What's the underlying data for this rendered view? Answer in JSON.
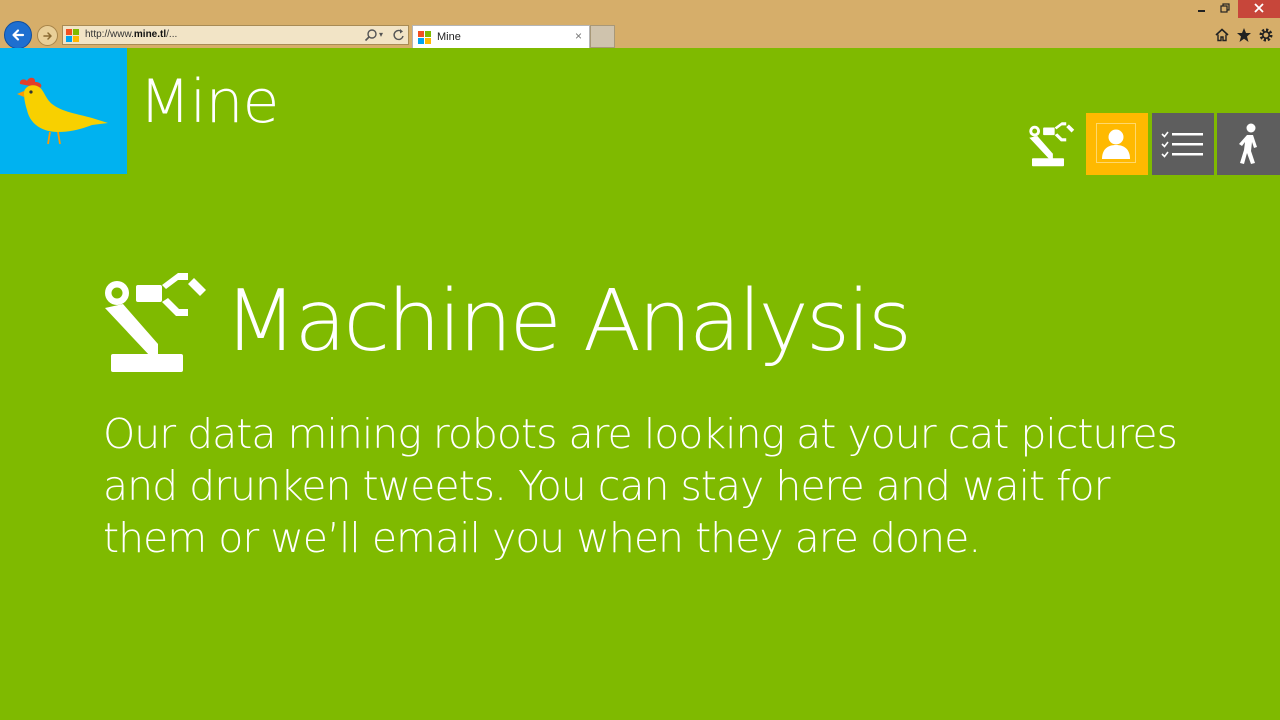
{
  "browser": {
    "address_prefix": "http://www.",
    "address_domain": "mine.tl",
    "address_suffix": "/...",
    "tab_title": "Mine",
    "tab_close": "×",
    "address_dropdown": "▾"
  },
  "app": {
    "title": "Mine",
    "colors": {
      "background": "#7fba00",
      "logo_tile": "#00b2f0",
      "user_tile": "#ffb900",
      "dark_tile": "#5e5e5e"
    }
  },
  "main": {
    "title": "Machine Analysis",
    "body_lines": [
      "Our data mining robots are looking at your cat pictures",
      "and drunken tweets. You can stay here and wait for",
      "them or we’ll email you when they are done."
    ]
  },
  "icons": {
    "back": "back-arrow-icon",
    "forward": "forward-arrow-icon",
    "logo": "bird-logo-icon",
    "robot": "robot-arm-icon",
    "user": "user-icon",
    "list": "checklist-icon",
    "walk": "walking-person-icon"
  }
}
